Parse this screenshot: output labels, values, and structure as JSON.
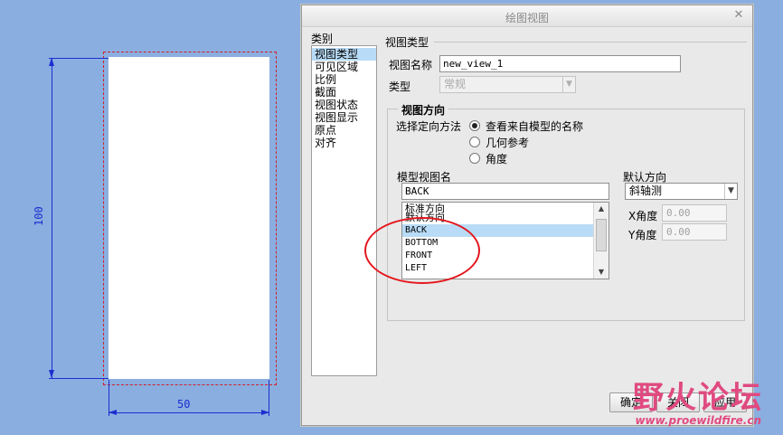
{
  "drawing": {
    "dim_vertical": "100",
    "dim_horizontal": "50"
  },
  "dialog": {
    "title": "绘图视图",
    "categories_label": "类别",
    "categories": [
      "视图类型",
      "可见区域",
      "比例",
      "截面",
      "视图状态",
      "视图显示",
      "原点",
      "对齐"
    ],
    "selected_category": "视图类型",
    "section_title": "视图类型",
    "view_name_label": "视图名称",
    "view_name_value": "new_view_1",
    "type_label": "类型",
    "type_value": "常规",
    "orientation_group_title": "视图方向",
    "orientation_method_label": "选择定向方法",
    "orientation_options": [
      "查看来自模型的名称",
      "几何参考",
      "角度"
    ],
    "orientation_selected": "查看来自模型的名称",
    "model_view_label": "模型视图名",
    "model_view_value": "BACK",
    "model_views": [
      "标准方向",
      "默认方向",
      "BACK",
      "BOTTOM",
      "FRONT",
      "LEFT"
    ],
    "model_view_selected": "BACK",
    "default_orientation_label": "默认方向",
    "default_orientation_value": "斜轴测",
    "x_angle_label": "X角度",
    "x_angle_value": "0.00",
    "y_angle_label": "Y角度",
    "y_angle_value": "0.00",
    "buttons": {
      "ok": "确定",
      "close": "关闭",
      "apply": "应用"
    }
  },
  "watermark": {
    "brand": "野火论坛",
    "url": "www.proewildfire.cn"
  },
  "colors": {
    "desktop": "#8aaee0",
    "dimension": "#1c2fd0",
    "frame": "#d0202a",
    "selection": "#b8dcf7",
    "annotation": "#e4161d"
  }
}
